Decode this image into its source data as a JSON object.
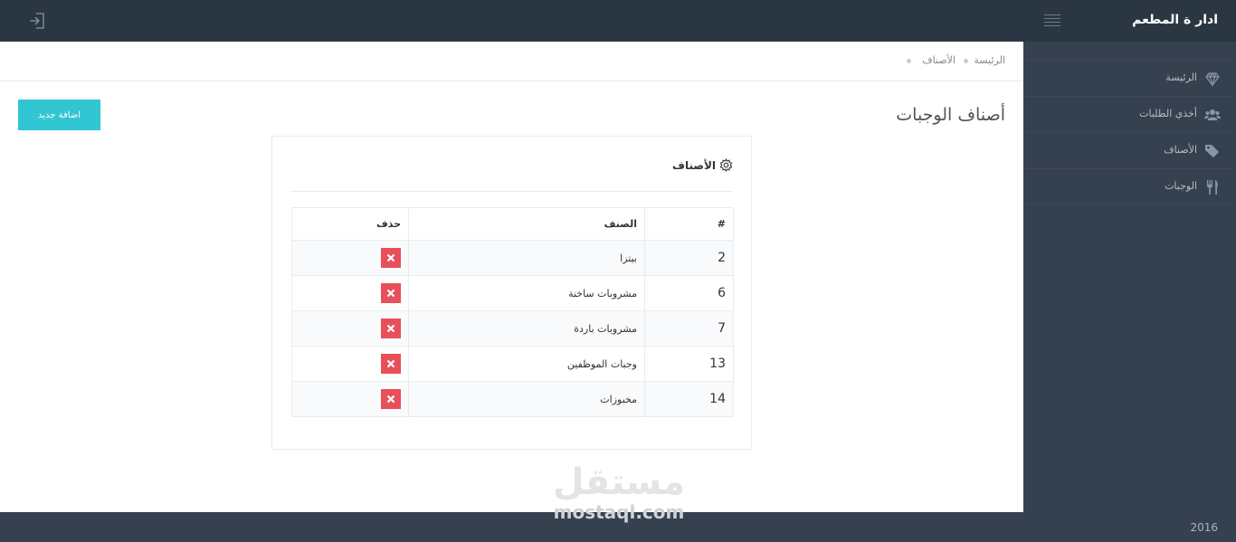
{
  "header": {
    "brand": "ادار ة المطعم",
    "logout_icon": "sign-out-icon",
    "menu_icon": "hamburger-icon"
  },
  "sidebar": {
    "items": [
      {
        "label": "الرئيسة",
        "icon": "diamond-icon"
      },
      {
        "label": "أخذي الطلبات",
        "icon": "users-icon"
      },
      {
        "label": "الأصناف",
        "icon": "tags-icon"
      },
      {
        "label": "الوجبات",
        "icon": "cutlery-icon"
      }
    ]
  },
  "breadcrumb": {
    "home": "الرئيسة",
    "current": "الأصناف"
  },
  "page": {
    "title": "أصناف الوجبات",
    "add_button": "اضافة جديد"
  },
  "portlet": {
    "title": "الأصناف",
    "icon": "gear-icon",
    "table": {
      "headers": [
        "#",
        "الصنف",
        "حذف"
      ],
      "rows": [
        {
          "id": "2",
          "name": "بيتزا"
        },
        {
          "id": "6",
          "name": "مشروبات ساخنة"
        },
        {
          "id": "7",
          "name": "مشروبات باردة"
        },
        {
          "id": "13",
          "name": "وجبات الموظفين"
        },
        {
          "id": "14",
          "name": "مخبوزات"
        }
      ]
    }
  },
  "watermark": {
    "arabic": "مستقل",
    "latin": "mostaql.com"
  },
  "footer": {
    "year": "2016"
  },
  "colors": {
    "topbar": "#2b3643",
    "sidebar": "#364150",
    "accent": "#32c5d2",
    "delete": "#e7505a"
  }
}
